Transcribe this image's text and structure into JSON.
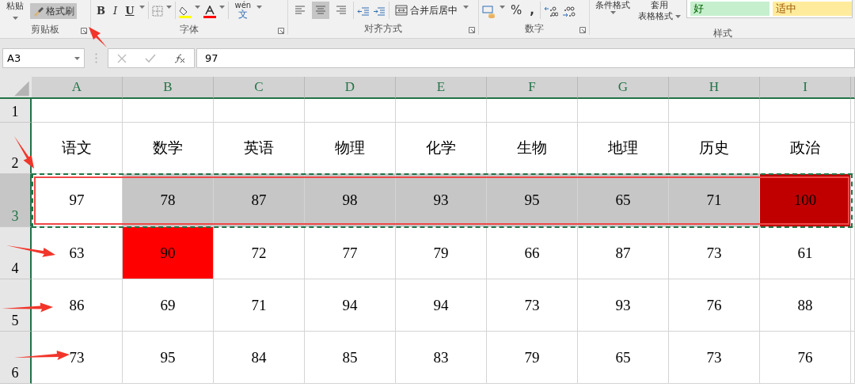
{
  "ribbon": {
    "groups": [
      {
        "kind": "clipboard",
        "label": "剪贴板",
        "paste": "粘贴",
        "painter": {
          "label": "格式刷",
          "selected": true
        }
      },
      {
        "kind": "font",
        "label": "字体",
        "bold": "B",
        "italic": "I",
        "underline": "U",
        "phonetic_top": "wén",
        "phonetic_bottom": "文"
      },
      {
        "kind": "align",
        "label": "对齐方式",
        "aligns": [
          {
            "selected": false
          },
          {
            "selected": true
          },
          {
            "selected": false
          }
        ],
        "merge": "合并后居中"
      },
      {
        "kind": "number",
        "label": "数字",
        "percent": "%",
        "comma": ","
      },
      {
        "kind": "styles",
        "label": "样式",
        "conditional": "条件格式",
        "table_top": "套用",
        "table": "表格格式",
        "cells": [
          {
            "text": "好",
            "color": "#c6efce"
          },
          {
            "text": "适中",
            "color": "#ffeb9c"
          }
        ]
      }
    ]
  },
  "formula_bar": {
    "name_box": "A3",
    "value": "97"
  },
  "sheet": {
    "columns": [
      {
        "label": "A"
      },
      {
        "label": "B"
      },
      {
        "label": "C"
      },
      {
        "label": "D"
      },
      {
        "label": "E"
      },
      {
        "label": "F"
      },
      {
        "label": "G"
      },
      {
        "label": "H"
      },
      {
        "label": "I"
      }
    ],
    "rows": [
      {
        "header": "1",
        "selected": false,
        "cells": [
          {},
          {},
          {},
          {},
          {},
          {},
          {},
          {},
          {}
        ]
      },
      {
        "header": "2",
        "selected": false,
        "cells": [
          {
            "text": "语文"
          },
          {
            "text": "数学"
          },
          {
            "text": "英语"
          },
          {
            "text": "物理"
          },
          {
            "text": "化学"
          },
          {
            "text": "生物"
          },
          {
            "text": "地理"
          },
          {
            "text": "历史"
          },
          {
            "text": "政治"
          }
        ]
      },
      {
        "header": "3",
        "selected": true,
        "cells": [
          {
            "text": "97",
            "active": true
          },
          {
            "text": "78"
          },
          {
            "text": "87"
          },
          {
            "text": "98"
          },
          {
            "text": "93"
          },
          {
            "text": "95"
          },
          {
            "text": "65"
          },
          {
            "text": "71"
          },
          {
            "text": "100",
            "color": "#c00000"
          }
        ]
      },
      {
        "header": "4",
        "selected": false,
        "cells": [
          {
            "text": "63"
          },
          {
            "text": "90",
            "color": "#ff0000"
          },
          {
            "text": "72"
          },
          {
            "text": "77"
          },
          {
            "text": "79"
          },
          {
            "text": "66"
          },
          {
            "text": "87"
          },
          {
            "text": "73"
          },
          {
            "text": "61"
          }
        ]
      },
      {
        "header": "5",
        "selected": false,
        "cells": [
          {
            "text": "86"
          },
          {
            "text": "69"
          },
          {
            "text": "71"
          },
          {
            "text": "94"
          },
          {
            "text": "94"
          },
          {
            "text": "73"
          },
          {
            "text": "93"
          },
          {
            "text": "76"
          },
          {
            "text": "88"
          }
        ]
      },
      {
        "header": "6",
        "selected": false,
        "cells": [
          {
            "text": "73"
          },
          {
            "text": "95"
          },
          {
            "text": "84"
          },
          {
            "text": "85"
          },
          {
            "text": "83"
          },
          {
            "text": "79"
          },
          {
            "text": "65"
          },
          {
            "text": "73"
          },
          {
            "text": "76"
          }
        ]
      }
    ]
  }
}
